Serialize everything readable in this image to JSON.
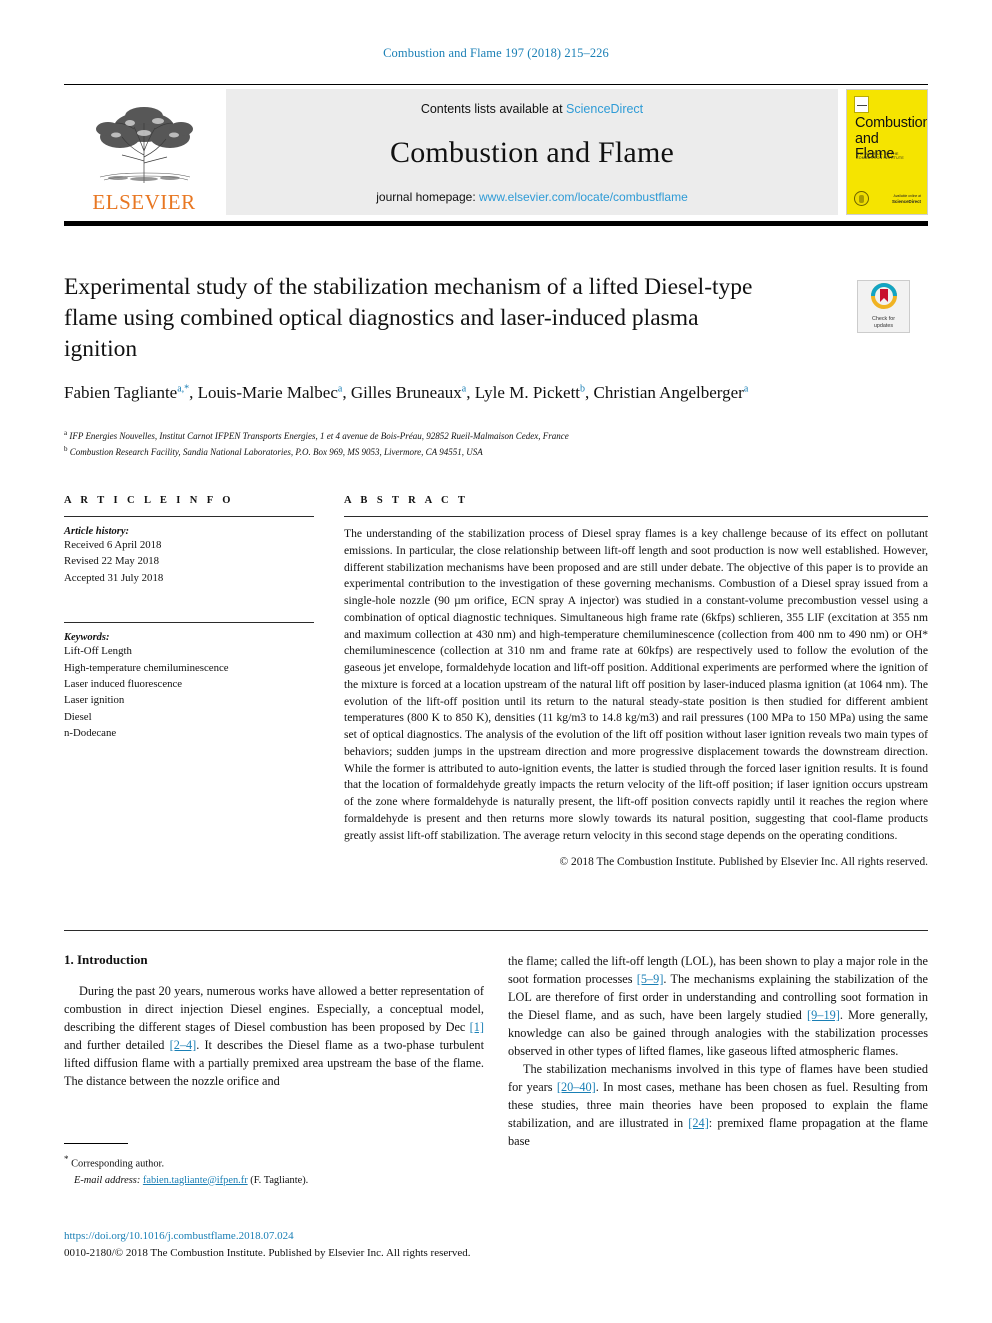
{
  "running_head": "Combustion and Flame 197 (2018) 215–226",
  "masthead": {
    "publisher": "ELSEVIER",
    "contents_prefix": "Contents lists available at ",
    "contents_link": "ScienceDirect",
    "journal_name": "Combustion and Flame",
    "homepage_prefix": "journal homepage: ",
    "homepage_link": "www.elsevier.com/locate/combustflame",
    "cover": {
      "title_line1": "Combustion",
      "title_line2": "and Flame",
      "subtitle": "THE JOURNAL OF THE COMBUSTION INSTITUTE",
      "footer_small": "Available online at",
      "footer_brand": "ScienceDirect"
    }
  },
  "article": {
    "title": "Experimental study of the stabilization mechanism of a lifted Diesel-type flame using combined optical diagnostics and laser-induced plasma ignition",
    "crossmark_label_line1": "Check for",
    "crossmark_label_line2": "updates",
    "authors": [
      {
        "name": "Fabien Tagliante",
        "sup": "a,*"
      },
      {
        "name": "Louis-Marie Malbec",
        "sup": "a"
      },
      {
        "name": "Gilles Bruneaux",
        "sup": "a"
      },
      {
        "name": "Lyle M. Pickett",
        "sup": "b"
      },
      {
        "name": "Christian Angelberger",
        "sup": "a"
      }
    ],
    "affiliations": [
      {
        "marker": "a",
        "text": "IFP Energies Nouvelles, Institut Carnot IFPEN Transports Energies, 1 et 4 avenue de Bois-Préau, 92852 Rueil-Malmaison Cedex, France"
      },
      {
        "marker": "b",
        "text": "Combustion Research Facility, Sandia National Laboratories, P.O. Box 969, MS 9053, Livermore, CA 94551, USA"
      }
    ]
  },
  "article_info": {
    "heading": "A R T I C L E   I N F O",
    "history_label": "Article history:",
    "history": [
      "Received 6 April 2018",
      "Revised 22 May 2018",
      "Accepted 31 July 2018"
    ],
    "keywords_label": "Keywords:",
    "keywords": [
      "Lift-Off Length",
      "High-temperature chemiluminescence",
      "Laser induced fluorescence",
      "Laser ignition",
      "Diesel",
      "n-Dodecane"
    ]
  },
  "abstract": {
    "heading": "A B S T R A C T",
    "text": "The understanding of the stabilization process of Diesel spray flames is a key challenge because of its effect on pollutant emissions. In particular, the close relationship between lift-off length and soot production is now well established. However, different stabilization mechanisms have been proposed and are still under debate. The objective of this paper is to provide an experimental contribution to the investigation of these governing mechanisms. Combustion of a Diesel spray issued from a single-hole nozzle (90 µm orifice, ECN spray A injector) was studied in a constant-volume precombustion vessel using a combination of optical diagnostic techniques. Simultaneous high frame rate (6kfps) schlieren, 355 LIF (excitation at 355 nm and maximum collection at 430 nm) and high-temperature chemiluminescence (collection from 400 nm to 490 nm) or OH* chemiluminescence (collection at 310 nm and frame rate at 60kfps) are respectively used to follow the evolution of the gaseous jet envelope, formaldehyde location and lift-off position. Additional experiments are performed where the ignition of the mixture is forced at a location upstream of the natural lift off position by laser-induced plasma ignition (at 1064 nm). The evolution of the lift-off position until its return to the natural steady-state position is then studied for different ambient temperatures (800 K to 850 K), densities (11 kg/m3 to 14.8 kg/m3) and rail pressures (100 MPa to 150 MPa) using the same set of optical diagnostics. The analysis of the evolution of the lift off position without laser ignition reveals two main types of behaviors; sudden jumps in the upstream direction and more progressive displacement towards the downstream direction. While the former is attributed to auto-ignition events, the latter is studied through the forced laser ignition results. It is found that the location of formaldehyde greatly impacts the return velocity of the lift-off position; if laser ignition occurs upstream of the zone where formaldehyde is naturally present, the lift-off position convects rapidly until it reaches the region where formaldehyde is present and then returns more slowly towards its natural position, suggesting that cool-flame products greatly assist lift-off stabilization. The average return velocity in this second stage depends on the operating conditions.",
    "copyright": "© 2018 The Combustion Institute. Published by Elsevier Inc. All rights reserved."
  },
  "body": {
    "section_heading": "1. Introduction",
    "left_paragraph_1_a": "During the past 20 years, numerous works have allowed a better representation of combustion in direct injection Diesel engines. Especially, a conceptual model, describing the different stages of Diesel combustion has been proposed by Dec ",
    "left_ref_1": "[1]",
    "left_paragraph_1_b": " and further detailed ",
    "left_ref_2": "[2–4]",
    "left_paragraph_1_c": ". It describes the Diesel flame as a two-phase turbulent lifted diffusion flame with a partially premixed area upstream the base of the flame. The distance between the nozzle orifice and",
    "right_paragraph_1_a": "the flame; called the lift-off length (LOL), has been shown to play a major role in the soot formation processes ",
    "right_ref_1": "[5–9]",
    "right_paragraph_1_b": ". The mechanisms explaining the stabilization of the LOL are therefore of first order in understanding and controlling soot formation in the Diesel flame, and as such, have been largely studied ",
    "right_ref_2": "[9–19]",
    "right_paragraph_1_c": ". More generally, knowledge can also be gained through analogies with the stabilization processes observed in other types of lifted flames, like gaseous lifted atmospheric flames.",
    "right_paragraph_2_a": "The stabilization mechanisms involved in this type of flames have been studied for years ",
    "right_ref_3": "[20–40]",
    "right_paragraph_2_b": ". In most cases, methane has been chosen as fuel. Resulting from these studies, three main theories have been proposed to explain the flame stabilization, and are illustrated in ",
    "right_ref_4": "[24]",
    "right_paragraph_2_c": ": premixed flame propagation at the flame base"
  },
  "footnote": {
    "corresponding_marker": "*",
    "corresponding_text": "Corresponding author.",
    "email_label": "E-mail address:",
    "email": "fabien.tagliante@ifpen.fr",
    "email_suffix": "(F. Tagliante)."
  },
  "footer": {
    "doi": "https://doi.org/10.1016/j.combustflame.2018.07.024",
    "issn_line": "0010-2180/© 2018 The Combustion Institute. Published by Elsevier Inc. All rights reserved."
  },
  "colors": {
    "link": "#1a7fb5",
    "link_light": "#2e9bd6",
    "elsevier_orange": "#E87722",
    "cover_yellow": "#F5E400",
    "panel_gray": "#ececec"
  }
}
